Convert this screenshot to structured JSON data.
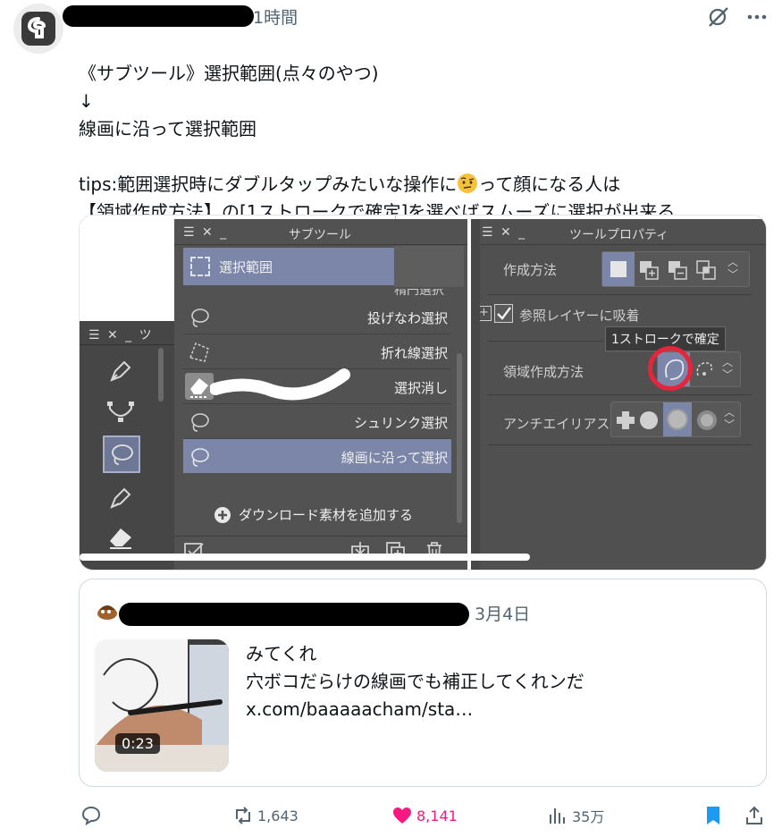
{
  "header": {
    "time": "1時間"
  },
  "tweet": {
    "text": "《サブツール》選択範囲(点々のやつ)\n↓\n線画に沿って選択範囲\n\ntips:範囲選択時にダブルタップみたいな操作に",
    "text_line4_end": "って顔になる人は",
    "text_line5": "【領域作成方法】の[1ストロークで確定]を選べばスムーズに選択が出来る"
  },
  "media": {
    "subtool_panel": {
      "title": "サブツール",
      "selected_header": "選択範囲",
      "items": [
        "投げなわ選択",
        "折れ線選択",
        "選択消し",
        "シュリンク選択",
        "線画に沿って選択"
      ],
      "add_material": "ダウンロード素材を追加する"
    },
    "left_panel_title": "ツ",
    "property_panel": {
      "title": "ツールプロパティ",
      "creation_method_label": "作成方法",
      "reference_layer_label": "参照レイヤーに吸着",
      "tooltip": "1ストロークで確定",
      "area_method_label": "領域作成方法",
      "antialias_label": "アンチエイリアス"
    },
    "accent_color": "#7b86a8",
    "highlight_circle_color": "#e8243b"
  },
  "quote": {
    "date": "3月4日",
    "text": "みてくれ\n穴ボコだらけの線画でも補正してくれンだ\nx.com/baaaaacham/sta…",
    "duration": "0:23"
  },
  "actions": {
    "retweets": "1,643",
    "likes": "8,141",
    "views": "35万",
    "like_color": "#f91880",
    "bookmark_color": "#1d9bf0"
  }
}
